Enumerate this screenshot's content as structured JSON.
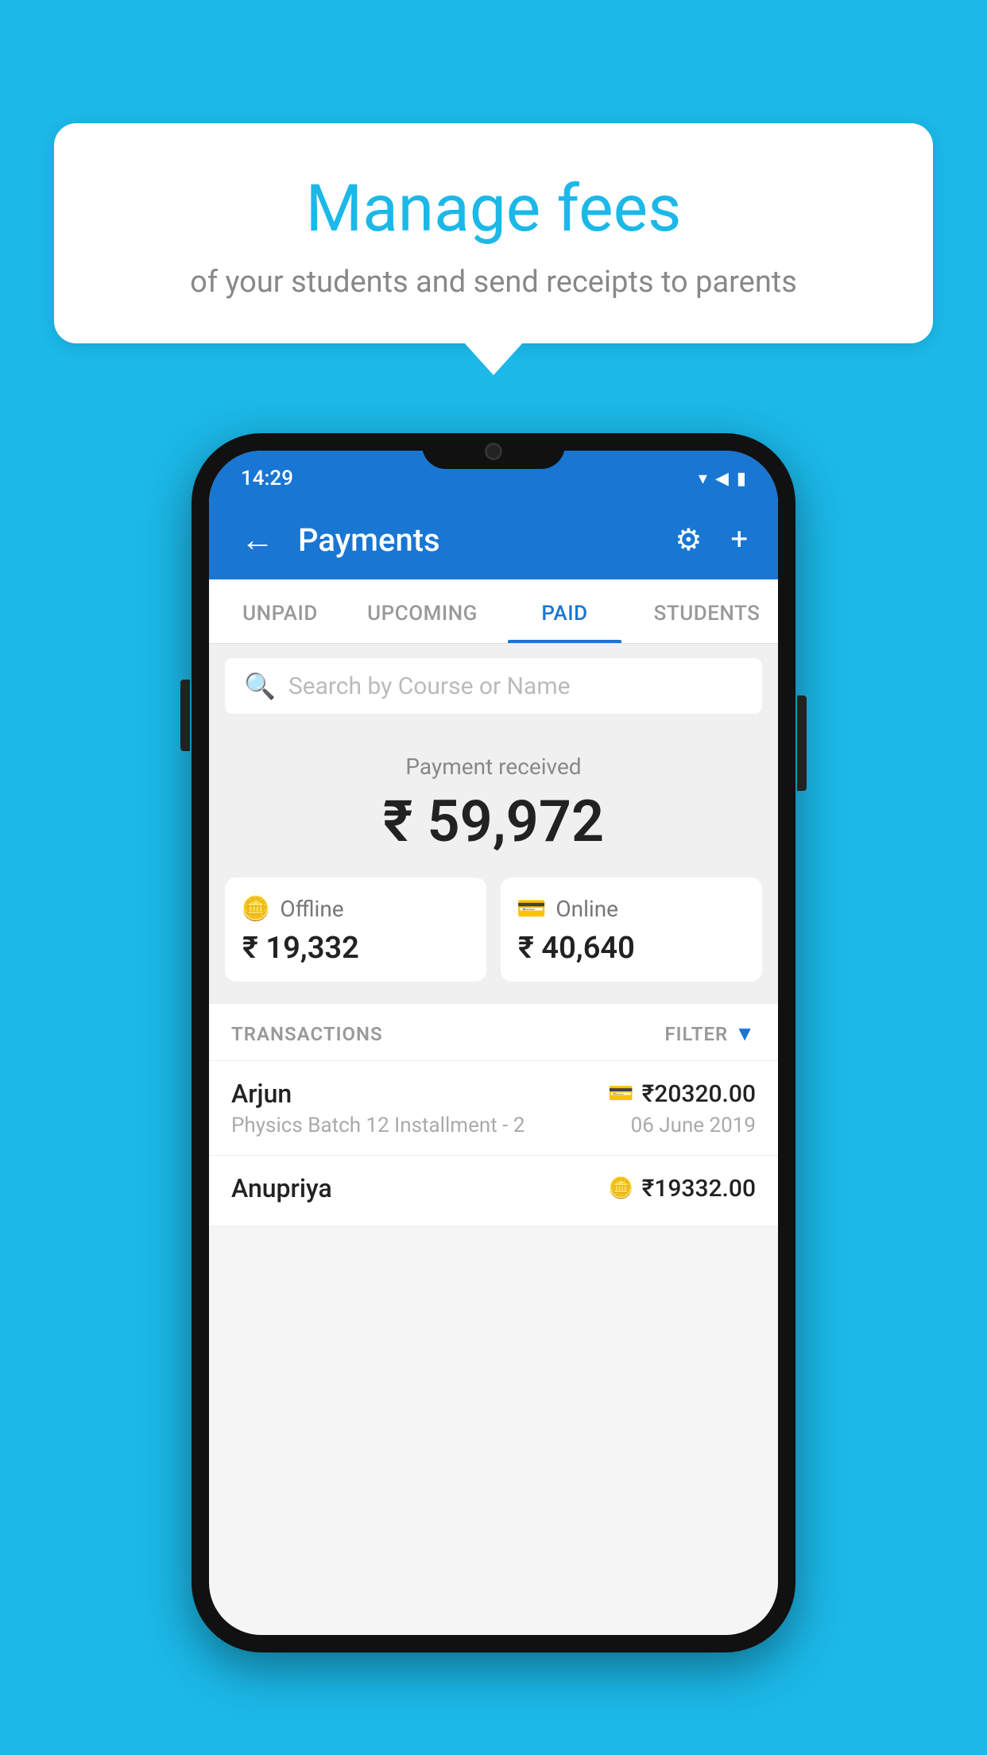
{
  "background_color": "#1BB8E8",
  "speech_bubble": {
    "title": "Manage fees",
    "subtitle": "of your students and send receipts to parents"
  },
  "status_bar": {
    "time": "14:29",
    "wifi": "▾",
    "signal": "▲",
    "battery": "▮"
  },
  "app_header": {
    "title": "Payments",
    "back_label": "←",
    "gear_label": "⚙",
    "plus_label": "+"
  },
  "tabs": [
    {
      "label": "UNPAID",
      "active": false
    },
    {
      "label": "UPCOMING",
      "active": false
    },
    {
      "label": "PAID",
      "active": true
    },
    {
      "label": "STUDENTS",
      "active": false
    }
  ],
  "search": {
    "placeholder": "Search by Course or Name"
  },
  "payment_summary": {
    "label": "Payment received",
    "amount": "₹ 59,972"
  },
  "offline_card": {
    "type": "Offline",
    "amount": "₹ 19,332"
  },
  "online_card": {
    "type": "Online",
    "amount": "₹ 40,640"
  },
  "transactions_header": {
    "label": "TRANSACTIONS",
    "filter_label": "FILTER"
  },
  "transactions": [
    {
      "name": "Arjun",
      "course": "Physics Batch 12 Installment - 2",
      "amount": "₹20320.00",
      "date": "06 June 2019",
      "payment_type": "card"
    },
    {
      "name": "Anupriya",
      "course": "",
      "amount": "₹19332.00",
      "date": "",
      "payment_type": "offline"
    }
  ]
}
